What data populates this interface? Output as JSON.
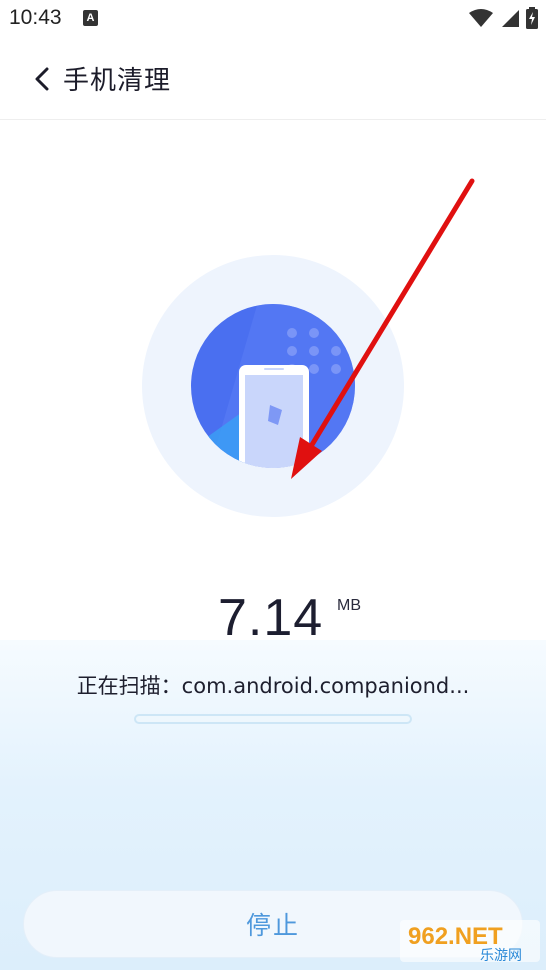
{
  "status_bar": {
    "time": "10:43",
    "app_icon_letter": "A",
    "icons": [
      "wifi-icon",
      "signal-icon",
      "battery-charging-icon"
    ]
  },
  "header": {
    "back_icon": "chevron-left-icon",
    "title": "手机清理"
  },
  "scan": {
    "icon": "phone-clean-icon",
    "size_value": "7.14",
    "size_unit": "MB",
    "status_text": "正在扫描：com.android.companiond...",
    "progress": 0.0
  },
  "actions": {
    "stop_label": "停止"
  },
  "watermark": {
    "main": "962.NET",
    "sub": "乐游网"
  },
  "colors": {
    "accent_blue": "#4e98dc",
    "circle_blue": "#4a6ff0",
    "annotation_red": "#e01010"
  }
}
